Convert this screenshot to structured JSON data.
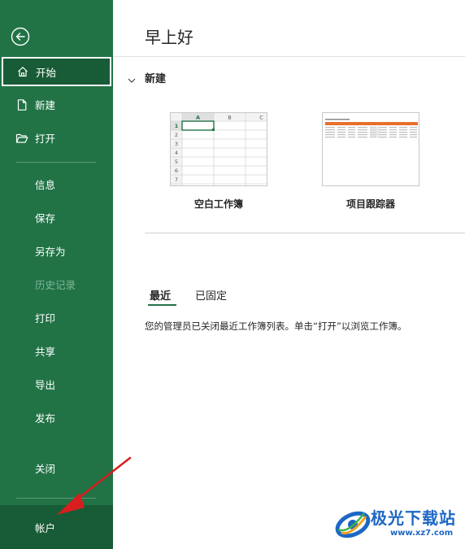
{
  "sidebar": {
    "items": [
      {
        "label": "开始",
        "icon": "home-icon",
        "active": true
      },
      {
        "label": "新建",
        "icon": "new-document-icon"
      },
      {
        "label": "打开",
        "icon": "open-folder-icon"
      },
      {
        "label": "信息"
      },
      {
        "label": "保存"
      },
      {
        "label": "另存为"
      },
      {
        "label": "历史记录",
        "disabled": true
      },
      {
        "label": "打印"
      },
      {
        "label": "共享"
      },
      {
        "label": "导出"
      },
      {
        "label": "发布"
      },
      {
        "label": "关闭"
      },
      {
        "label": "帐户"
      }
    ]
  },
  "main": {
    "greeting": "早上好",
    "new_section": {
      "title": "新建",
      "templates": [
        {
          "name": "空白工作簿"
        },
        {
          "name": "项目跟踪器"
        }
      ],
      "blank_grid": {
        "columns": [
          "A",
          "B",
          "C"
        ],
        "rows": [
          "1",
          "2",
          "3",
          "4",
          "5",
          "6",
          "7"
        ]
      }
    },
    "tabs": [
      {
        "label": "最近",
        "selected": true
      },
      {
        "label": "已固定"
      }
    ],
    "recent_message": "您的管理员已关闭最近工作簿列表。单击“打开”以浏览工作簿。"
  },
  "watermark": {
    "title": "极光下载站",
    "url": "www.xz7.com"
  },
  "colors": {
    "sidebar_bg": "#217346",
    "sidebar_active": "#185c37",
    "accent": "#217346",
    "annotation_arrow": "#d81e1e",
    "watermark": "#1d67c4"
  }
}
